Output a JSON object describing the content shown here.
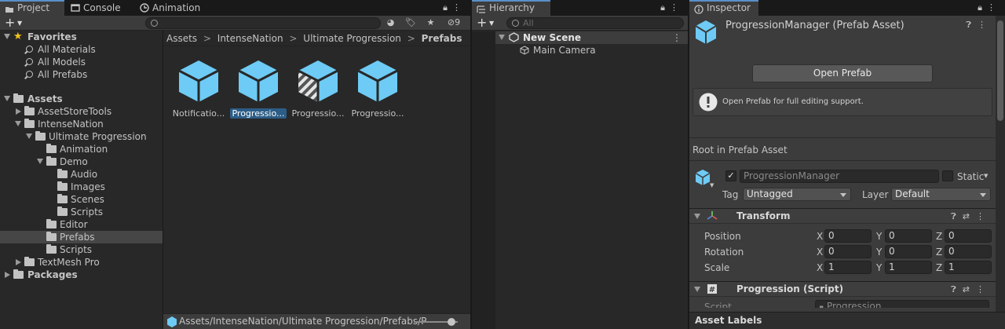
{
  "project": {
    "tabs": {
      "project": "Project",
      "console": "Console",
      "animation": "Animation"
    },
    "badge_count": "9",
    "favorites": {
      "label": "Favorites",
      "items": [
        "All Materials",
        "All Models",
        "All Prefabs"
      ]
    },
    "tree": {
      "assets": "Assets",
      "asset_store_tools": "AssetStoreTools",
      "intense_nation": "IntenseNation",
      "ultimate_progression": "Ultimate Progression",
      "animation": "Animation",
      "demo": "Demo",
      "audio": "Audio",
      "images": "Images",
      "scenes": "Scenes",
      "scripts_demo": "Scripts",
      "editor": "Editor",
      "prefabs": "Prefabs",
      "scripts": "Scripts",
      "textmesh_pro": "TextMesh Pro",
      "packages": "Packages"
    },
    "breadcrumb": [
      "Assets",
      "IntenseNation",
      "Ultimate Progression",
      "Prefabs"
    ],
    "assets_grid": [
      "Notificatio...",
      "Progressio...",
      "Progressio...",
      "Progressio..."
    ],
    "status_path": "Assets/IntenseNation/Ultimate Progression/Prefabs/P",
    "thumb_slider": 0.85
  },
  "hierarchy": {
    "tab": "Hierarchy",
    "search_placeholder": "All",
    "scene": "New Scene",
    "items": [
      "Main Camera"
    ]
  },
  "inspector": {
    "tab": "Inspector",
    "title": "ProgressionManager (Prefab Asset)",
    "open_prefab": "Open Prefab",
    "info": "Open Prefab for full editing support.",
    "root_label": "Root in Prefab Asset",
    "object_name": "ProgressionManager",
    "static_label": "Static",
    "tag_label": "Tag",
    "tag_value": "Untagged",
    "layer_label": "Layer",
    "layer_value": "Default",
    "transform": {
      "title": "Transform",
      "rows": [
        {
          "label": "Position",
          "x": "0",
          "y": "0",
          "z": "0"
        },
        {
          "label": "Rotation",
          "x": "0",
          "y": "0",
          "z": "0"
        },
        {
          "label": "Scale",
          "x": "1",
          "y": "1",
          "z": "1"
        }
      ]
    },
    "axis_labels": {
      "x": "X",
      "y": "Y",
      "z": "Z"
    },
    "script": {
      "title": "Progression (Script)",
      "field_label": "Script",
      "field_value": "Progression"
    },
    "asset_labels": "Asset Labels"
  },
  "colors": {
    "accent": "#5a8fc9",
    "prefab_blue": "#6ecbf5",
    "selection": "#2c5d87"
  }
}
